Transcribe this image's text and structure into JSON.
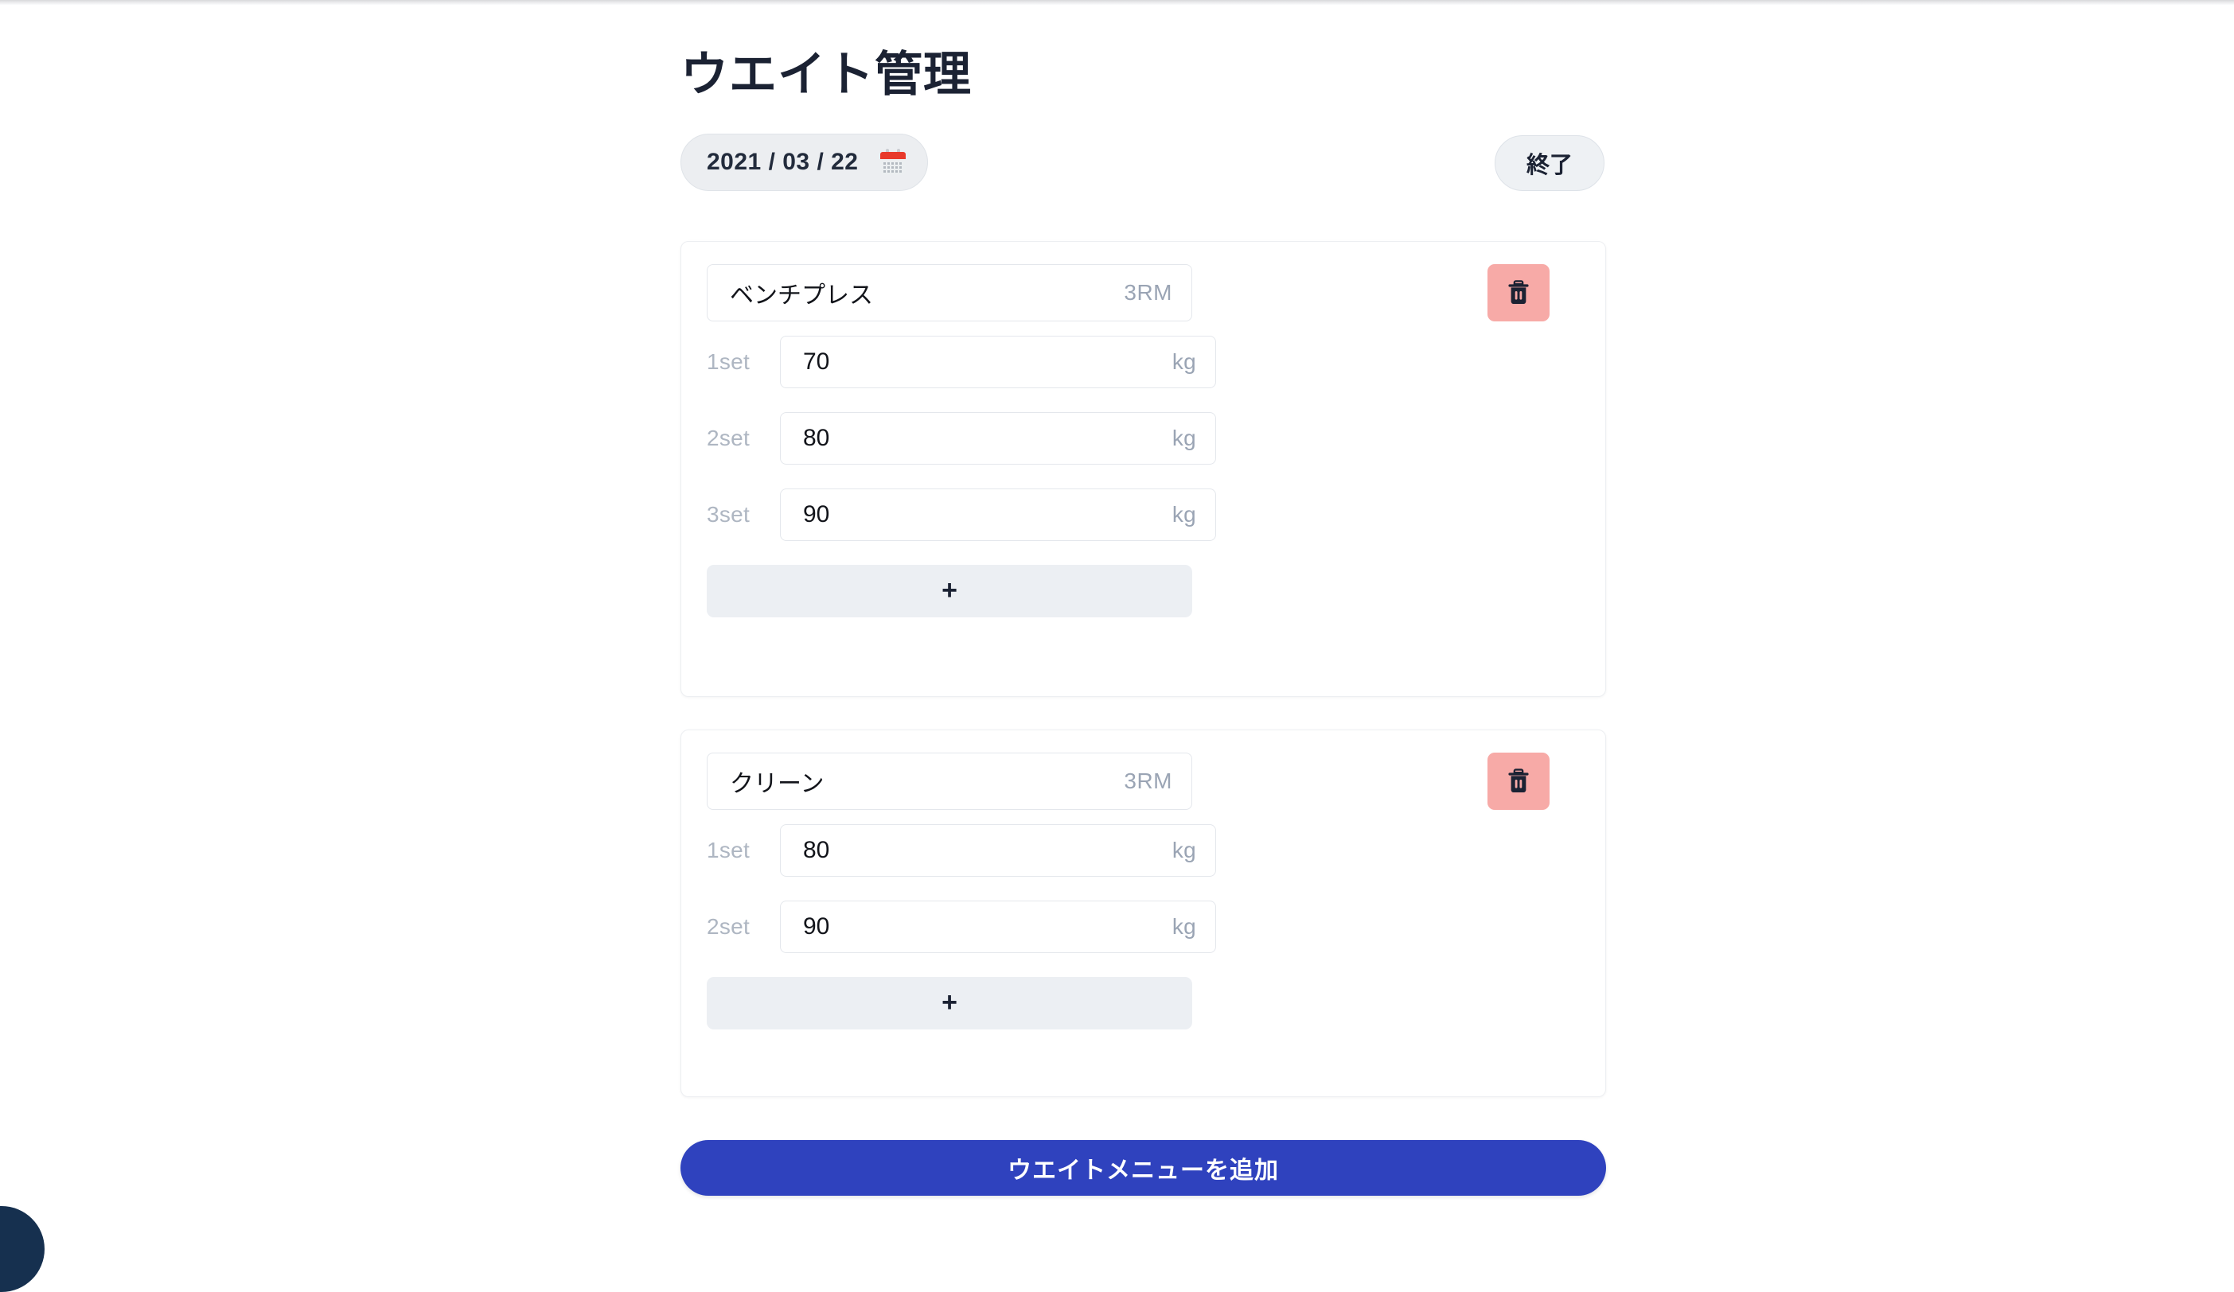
{
  "page": {
    "title": "ウエイト管理"
  },
  "toolbar": {
    "date_value": "2021 / 03 / 22",
    "calendar_icon": "calendar-icon",
    "end_label": "終了"
  },
  "cards": [
    {
      "name": "ベンチプレス",
      "rm_unit": "3RM",
      "delete_icon": "trash-icon",
      "sets": [
        {
          "label": "1set",
          "value": "70",
          "unit": "kg"
        },
        {
          "label": "2set",
          "value": "80",
          "unit": "kg"
        },
        {
          "label": "3set",
          "value": "90",
          "unit": "kg"
        }
      ],
      "add_set_label": "+"
    },
    {
      "name": "クリーン",
      "rm_unit": "3RM",
      "delete_icon": "trash-icon",
      "sets": [
        {
          "label": "1set",
          "value": "80",
          "unit": "kg"
        },
        {
          "label": "2set",
          "value": "90",
          "unit": "kg"
        }
      ],
      "add_set_label": "+"
    }
  ],
  "footer": {
    "add_menu_label": "ウエイトメニューを追加"
  },
  "colors": {
    "primary": "#2f42be",
    "danger_bg": "#f7aaa7",
    "pill_bg": "#eceef1",
    "add_set_bg": "#eceff3",
    "text_dark": "#1b2233",
    "text_muted": "#9aa4b4"
  }
}
